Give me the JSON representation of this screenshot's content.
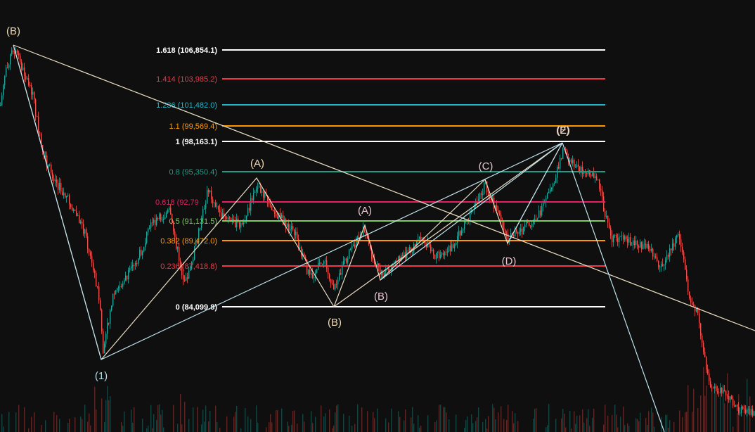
{
  "chart": {
    "type": "candlestick-with-elliott-waves",
    "colors": {
      "background": "#0f0f0f",
      "up_candle": "#26a69a",
      "down_candle": "#ef5350",
      "wave_line": "#e9dcc2",
      "wave_line_alt": "#bfe3ee",
      "label_wave": "#efd9b3",
      "label_sub": "#e8c7d3",
      "label_cyan": "#b7dce8"
    },
    "fib_levels": [
      {
        "label": "1.618 (106,854.1)",
        "color": "#ffffff"
      },
      {
        "label": "1.414 (103,985.2)",
        "color": "#f23645"
      },
      {
        "label": "1.236 (101,482.0)",
        "color": "#22b5c9"
      },
      {
        "label": "1.1 (99,569.4)",
        "color": "#ff9800"
      },
      {
        "label": "1 (98,163.1)",
        "color": "#ffffff"
      },
      {
        "label": "0.8 (95,350.4)",
        "color": "#1a9e8a"
      },
      {
        "label": "0.618 (92,79",
        "color": "#e91e63"
      },
      {
        "label": "0.5 (91,131.5)",
        "color": "#7ccd5a"
      },
      {
        "label": "0.382 (89,472.0)",
        "color": "#ff9800"
      },
      {
        "label": "0.236 (87,418.8)",
        "color": "#f23645"
      },
      {
        "label": "0 (84,099.8)",
        "color": "#ffffff"
      }
    ],
    "wave_labels": [
      {
        "text": "(B)",
        "tone": "label_wave"
      },
      {
        "text": "(A)",
        "tone": "label_wave"
      },
      {
        "text": "(A)",
        "tone": "label_sub"
      },
      {
        "text": "(B)",
        "tone": "label_sub"
      },
      {
        "text": "(B)",
        "tone": "label_wave"
      },
      {
        "text": "(C)",
        "tone": "label_sub"
      },
      {
        "text": "(D)",
        "tone": "label_sub"
      },
      {
        "text": "(E)",
        "tone": "label_sub"
      },
      {
        "text": "(2)",
        "tone": "label_wave"
      },
      {
        "text": "(1)",
        "tone": "label_cyan"
      }
    ]
  }
}
